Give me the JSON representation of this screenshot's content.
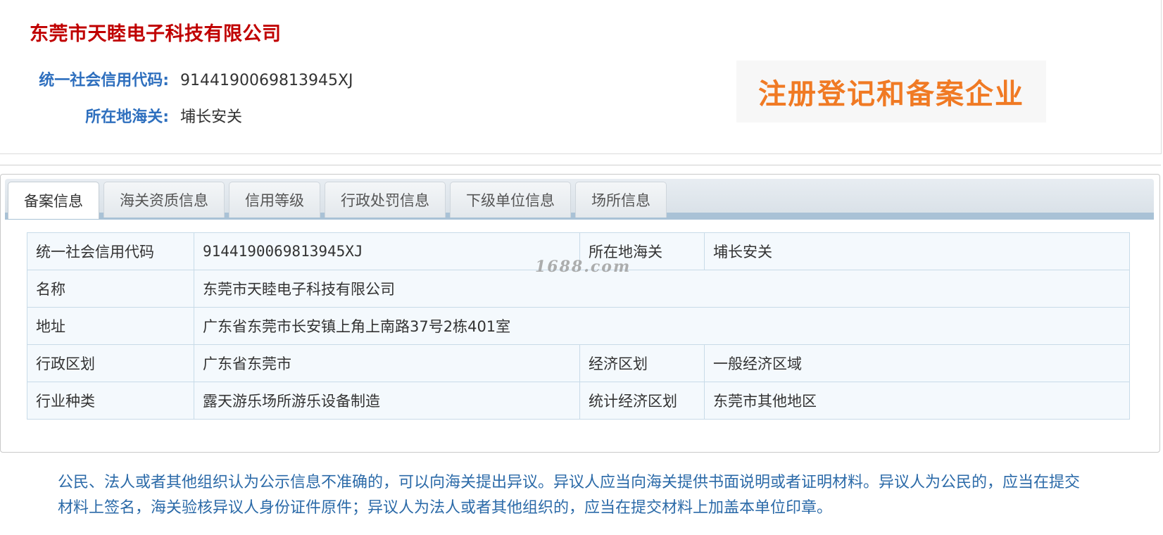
{
  "header": {
    "company_name": "东莞市天睦电子科技有限公司",
    "credit_code_label": "统一社会信用代码:",
    "credit_code_value": "9144190069813945XJ",
    "customs_label": "所在地海关:",
    "customs_value": "埔长安关",
    "badge_text": "注册登记和备案企业"
  },
  "tabs": [
    {
      "label": "备案信息",
      "active": true
    },
    {
      "label": "海关资质信息"
    },
    {
      "label": "信用等级"
    },
    {
      "label": "行政处罚信息"
    },
    {
      "label": "下级单位信息"
    },
    {
      "label": "场所信息"
    }
  ],
  "table": {
    "credit_code_label": "统一社会信用代码",
    "credit_code_value": "9144190069813945XJ",
    "customs_label": "所在地海关",
    "customs_value": "埔长安关",
    "name_label": "名称",
    "name_value": "东莞市天睦电子科技有限公司",
    "address_label": "地址",
    "address_value": "广东省东莞市长安镇上角上南路37号2栋401室",
    "admin_region_label": "行政区划",
    "admin_region_value": "广东省东莞市",
    "economic_zone_label": "经济区划",
    "economic_zone_value": "一般经济区域",
    "industry_label": "行业种类",
    "industry_value": "露天游乐场所游乐设备制造",
    "stat_zone_label": "统计经济区划",
    "stat_zone_value": "东莞市其他地区"
  },
  "watermark": "1688.com",
  "notice": "公民、法人或者其他组织认为公示信息不准确的，可以向海关提出异议。异议人应当向海关提供书面说明或者证明材料。异议人为公民的，应当在提交材料上签名，海关验核异议人身份证件原件；异议人为法人或者其他组织的，应当在提交材料上加盖本单位印章。",
  "colors": {
    "company_title": "#c00000",
    "label_blue": "#2e6fbe",
    "badge_orange": "#f07a24",
    "notice_blue": "#2b6aa8"
  }
}
